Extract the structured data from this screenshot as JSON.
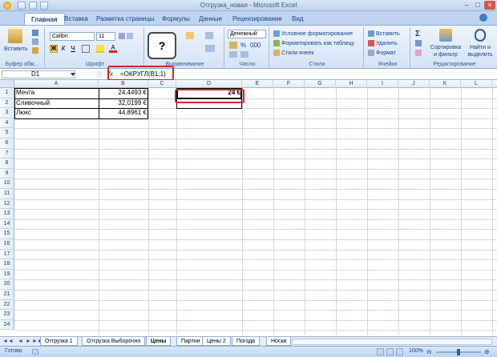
{
  "title": "Отгрузка_новая - Microsoft Excel",
  "window_buttons": [
    "–",
    "□",
    "×"
  ],
  "ribbon_tabs": [
    "Главная",
    "Вставка",
    "Разметка страницы",
    "Формулы",
    "Данные",
    "Рецензирование",
    "Вид"
  ],
  "ribbon": {
    "paste_label": "Вставить",
    "clipboard_group": "Буфер обм...",
    "font_name": "Calibri",
    "font_size": "11",
    "font_group": "Шрифт",
    "alignment_group": "Выравнивание",
    "number_format": "Денежный",
    "number_group": "Число",
    "cond_format": "Условное форматирование",
    "format_table": "Форматировать как таблицу",
    "cell_styles": "Стили ячеек",
    "styles_group": "Стили",
    "insert": "Вставить",
    "delete": "Удалить",
    "format": "Формат",
    "cells_group": "Ячейки",
    "sort_filter": "Сортировка и фильтр",
    "find_select": "Найти и выделить",
    "editing_group": "Редактирование"
  },
  "callout": "?",
  "name_box": "D1",
  "fx": "fx",
  "formula": "=ОКРУГЛ(B1;1)",
  "columns": [
    "A",
    "B",
    "C",
    "D",
    "E",
    "F",
    "G",
    "H",
    "I",
    "J",
    "K",
    "L"
  ],
  "rows": [
    "1",
    "2",
    "3",
    "4",
    "5",
    "6",
    "7",
    "8",
    "9",
    "10",
    "11",
    "12",
    "13",
    "14",
    "15",
    "16",
    "17",
    "18",
    "19",
    "20",
    "21",
    "22",
    "23",
    "24"
  ],
  "cells": {
    "A1": "Мечта",
    "B1": "24,4493 €",
    "D1": "24 €",
    "A2": "Сливочный",
    "B2": "32,0199 €",
    "A3": "Люкс",
    "B3": "44,8961 €"
  },
  "sheet_tabs": [
    "Отгрузка 1",
    "Отгрузка Выборочно",
    "Цены",
    "Партии",
    "Цены 2",
    "Погода",
    "Носки"
  ],
  "active_sheet": "Цены",
  "status": "Готово",
  "zoom": "100%"
}
